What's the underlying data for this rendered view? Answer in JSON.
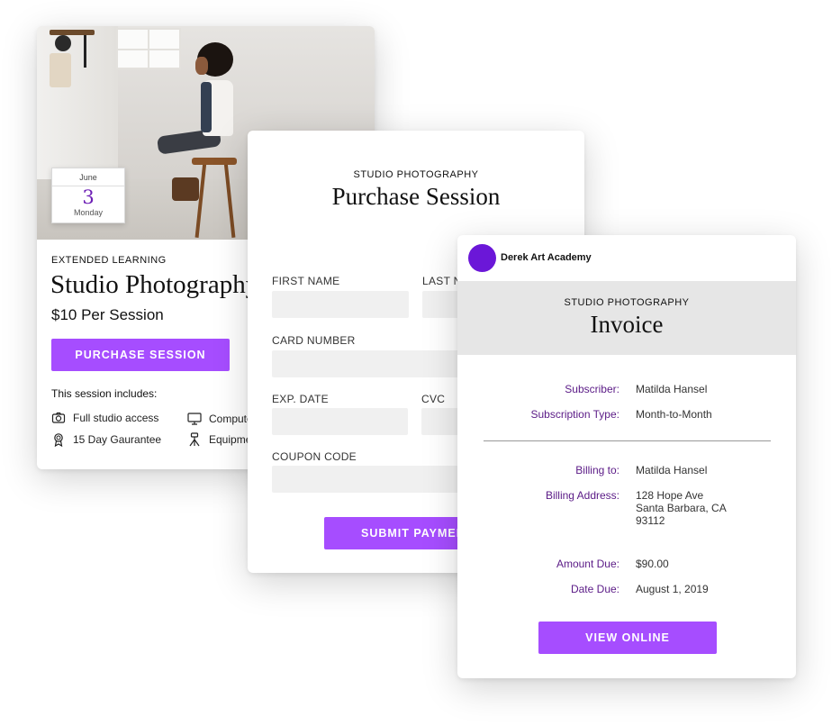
{
  "class_card": {
    "date": {
      "month": "June",
      "day": "3",
      "weekday": "Monday"
    },
    "eyebrow": "EXTENDED LEARNING",
    "title": "Studio Photography",
    "price": "$10 Per Session",
    "purchase_button": "PURCHASE SESSION",
    "includes_label": "This session includes:",
    "features": [
      {
        "label": "Full studio access",
        "icon": "camera-icon"
      },
      {
        "label": "Computer",
        "icon": "monitor-icon"
      },
      {
        "label": "15 Day Gaurantee",
        "icon": "award-ribbon-icon"
      },
      {
        "label": "Equipment",
        "icon": "tripod-icon"
      }
    ]
  },
  "purchase_form": {
    "eyebrow": "STUDIO PHOTOGRAPHY",
    "title": "Purchase Session",
    "fields": {
      "first_name": {
        "label": "FIRST NAME",
        "value": ""
      },
      "last_name": {
        "label": "LAST NAME",
        "value": ""
      },
      "card_number": {
        "label": "CARD NUMBER",
        "value": ""
      },
      "exp_date": {
        "label": "EXP. DATE",
        "value": ""
      },
      "cvc": {
        "label": "CVC",
        "value": ""
      },
      "coupon_code": {
        "label": "COUPON CODE",
        "value": ""
      }
    },
    "submit_button": "SUBMIT PAYMENT"
  },
  "invoice": {
    "org_name": "Derek Art Academy",
    "eyebrow": "STUDIO PHOTOGRAPHY",
    "title": "Invoice",
    "rows": [
      {
        "label": "Subscriber:",
        "value": "Matilda Hansel"
      },
      {
        "label": "Subscription Type:",
        "value": "Month-to-Month"
      },
      {
        "label": "Billing to:",
        "value": "Matilda Hansel"
      },
      {
        "label": "Billing Address:",
        "value": "128 Hope Ave\nSanta Barbara, CA\n93112"
      },
      {
        "label": "Amount Due:",
        "value": "$90.00"
      },
      {
        "label": "Date Due:",
        "value": "August 1, 2019"
      }
    ],
    "view_button": "VIEW ONLINE"
  },
  "colors": {
    "accent": "#a64dff",
    "brand_dot": "#6b17d8",
    "label_purple": "#5a1a86",
    "input_bg": "#f0f0f0",
    "invoice_header_bg": "#e6e6e6"
  }
}
